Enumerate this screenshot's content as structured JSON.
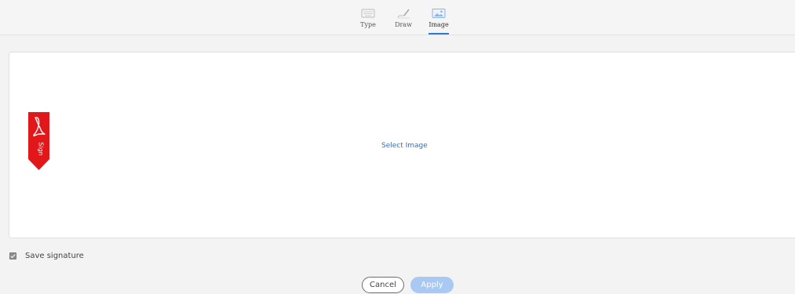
{
  "tabs": [
    {
      "label": "Type",
      "icon": "keyboard-icon",
      "active": false
    },
    {
      "label": "Draw",
      "icon": "pen-draw-icon",
      "active": false
    },
    {
      "label": "Image",
      "icon": "image-icon",
      "active": true
    }
  ],
  "panel": {
    "select_image_label": "Select Image",
    "flag_text": "Sign",
    "flag_color": "#e2171a"
  },
  "save_signature": {
    "label": "Save signature",
    "checked": true
  },
  "buttons": {
    "cancel_label": "Cancel",
    "apply_label": "Apply"
  },
  "colors": {
    "accent": "#2d7ad6",
    "link": "#2d6fcb",
    "apply_disabled": "#a9c9f2"
  }
}
